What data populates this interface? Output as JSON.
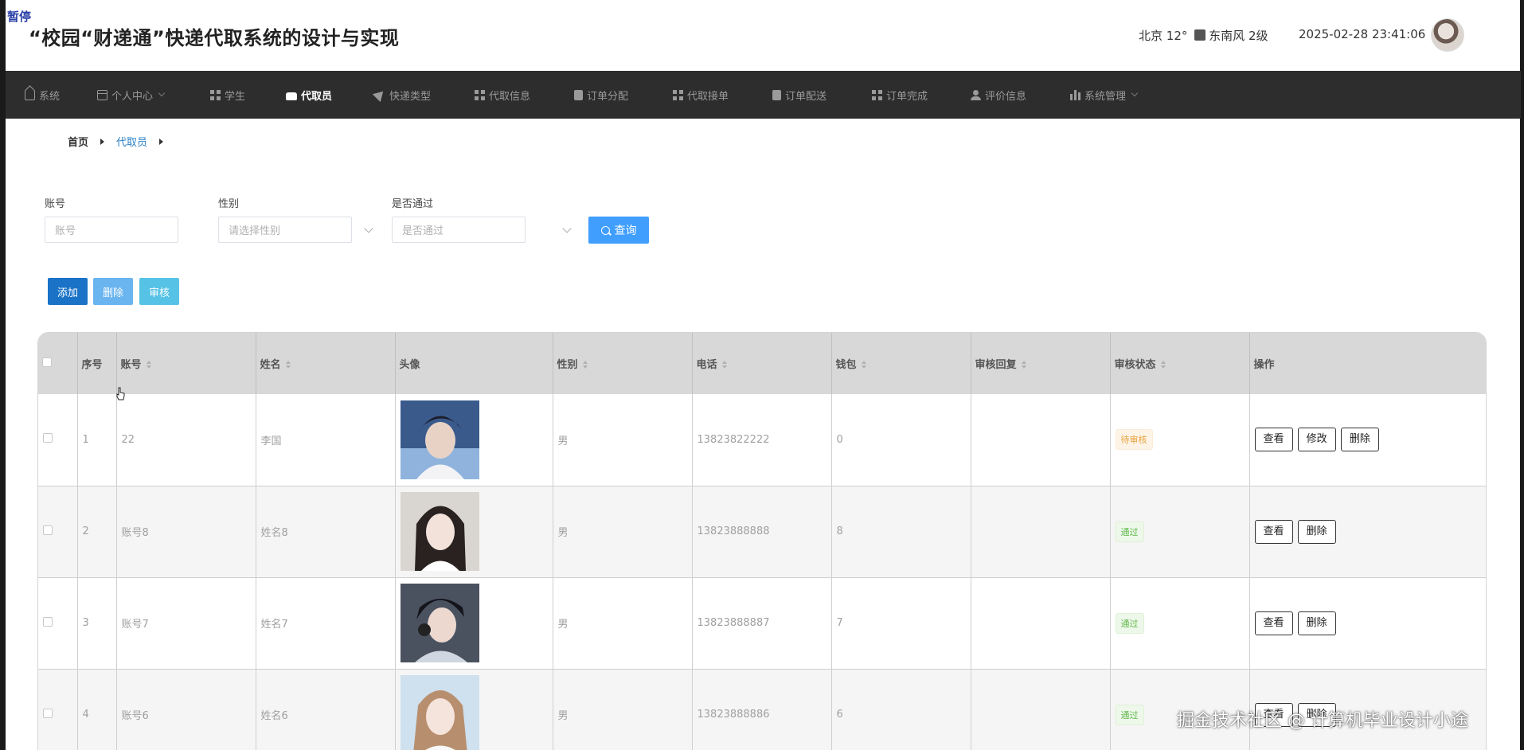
{
  "header": {
    "pause_label": "暂停",
    "title": "“校园“财递通”快递代取系统的设计与实现",
    "weather": {
      "city": "北京",
      "temp": "12°",
      "icon": "haze-icon",
      "wind": "东南风 2级"
    },
    "datetime": "2025-02-28 23:41:06"
  },
  "nav": {
    "items": [
      {
        "label": "系统",
        "icon": "home-icon"
      },
      {
        "label": "个人中心",
        "icon": "card-icon",
        "dropdown": true
      },
      {
        "label": "学生",
        "icon": "grid-icon"
      },
      {
        "label": "代取员",
        "icon": "hand-icon",
        "active": true
      },
      {
        "label": "快递类型",
        "icon": "plane-icon"
      },
      {
        "label": "代取信息",
        "icon": "grid-icon"
      },
      {
        "label": "订单分配",
        "icon": "clipboard-icon"
      },
      {
        "label": "代取接单",
        "icon": "grid-icon"
      },
      {
        "label": "订单配送",
        "icon": "clipboard-icon"
      },
      {
        "label": "订单完成",
        "icon": "grid-icon"
      },
      {
        "label": "评价信息",
        "icon": "user-icon"
      },
      {
        "label": "系统管理",
        "icon": "bars-icon",
        "dropdown": true
      }
    ]
  },
  "breadcrumb": {
    "home": "首页",
    "current": "代取员"
  },
  "search": {
    "account_label": "账号",
    "account_placeholder": "账号",
    "gender_label": "性别",
    "gender_placeholder": "请选择性别",
    "approved_label": "是否通过",
    "approved_placeholder": "是否通过",
    "query_button": "查询"
  },
  "actions": {
    "add": "添加",
    "delete": "删除",
    "audit": "审核"
  },
  "colors": {
    "nav_bg": "#2d2d2d",
    "primary": "#409eff",
    "add": "#1a73c6",
    "delete": "#6ab4f0",
    "audit": "#56c2e6"
  },
  "table": {
    "columns": [
      "序号",
      "账号",
      "姓名",
      "头像",
      "性别",
      "电话",
      "钱包",
      "审核回复",
      "审核状态",
      "操作"
    ],
    "rows": [
      {
        "index": "1",
        "account": "22",
        "name": "李国",
        "gender": "男",
        "phone": "13823822222",
        "wallet": "0",
        "reply": "",
        "status": "待审核",
        "ops": [
          "查看",
          "修改",
          "删除"
        ]
      },
      {
        "index": "2",
        "account": "账号8",
        "name": "姓名8",
        "gender": "男",
        "phone": "13823888888",
        "wallet": "8",
        "reply": "",
        "status": "通过",
        "ops": [
          "查看",
          "删除"
        ]
      },
      {
        "index": "3",
        "account": "账号7",
        "name": "姓名7",
        "gender": "男",
        "phone": "13823888887",
        "wallet": "7",
        "reply": "",
        "status": "通过",
        "ops": [
          "查看",
          "删除"
        ]
      },
      {
        "index": "4",
        "account": "账号6",
        "name": "姓名6",
        "gender": "男",
        "phone": "13823888886",
        "wallet": "6",
        "reply": "",
        "status": "通过",
        "ops": [
          "查看",
          "删除"
        ]
      }
    ]
  },
  "watermark": "掘金技术社区 @ 计算机毕业设计小途"
}
